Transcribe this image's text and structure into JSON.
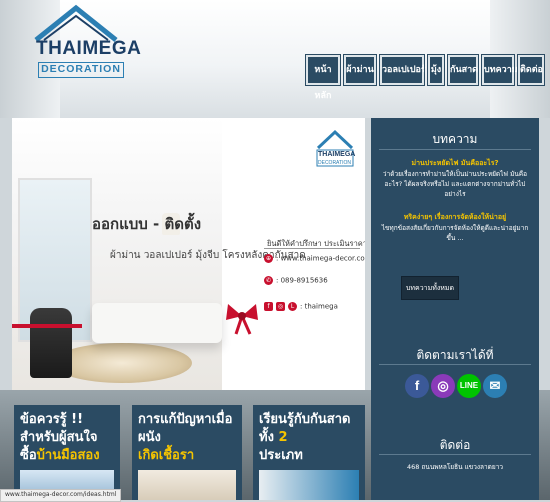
{
  "logo": {
    "title": "THAIMEGA",
    "subtitle": "DECORATION"
  },
  "nav": [
    "หน้าหลัก",
    "ผ้าม่าน",
    "วอลเปเปอร์",
    "มุ้ง",
    "กันสาด",
    "บทความ",
    "ติดต่อ"
  ],
  "slider": {
    "headline": "ออกแบบ - ติดตั้ง",
    "products": "ผ้าม่าน วอลเปเปอร์ มุ้งจีบ โครงหลังคากันสาด",
    "logo_title": "THAIMEGA",
    "logo_subtitle": "DECORATION",
    "tagline": "ยินดีให้คำปรึกษา ประเมินราคาฟรี",
    "website": ": www.thaimega-decor.com",
    "phone": ": 089-8915636",
    "social": ": thaimega"
  },
  "sidebar": {
    "articles_title": "บทความ",
    "article1_title": "ม่านประหยัดไฟ มันคืออะไร?",
    "article1_text": "ว่าด้วยเรื่องการทำม่านให้เป็นม่านประหยัดไฟ มันคืออะไร? ได้ผลจริงหรือไม่ และแตกต่างจากม่านทั่วไปอย่างไร",
    "article2_title": "ทริคง่ายๆ เรื่องการจัดห้องให้น่าอยู่",
    "article2_text": "ไขทุกข้อสงสัยเกี่ยวกับการจัดห้องให้ดูดีและน่าอยู่มากขึ้น ...",
    "read_more": "บทความทั้งหมด",
    "follow_title": "ติดตามเราได้ที่",
    "contact_title": "ติดต่อ",
    "contact_text": "468 ถนนพหลโยธิน แขวงลาดยาว"
  },
  "cards": [
    {
      "title": "ข้อควรรู้ !! สำหรับผู้สนใจซื้อ",
      "accent": "บ้านมือสอง"
    },
    {
      "title": "การแก้ปัญหาเมื่อผนัง",
      "accent": "เกิดเชื้อรา"
    },
    {
      "title": "เรียนรู้กับกันสาดทั้ง",
      "accent": "2",
      "tail": "ประเภท"
    }
  ],
  "status_url": "www.thaimega-decor.com/ideas.html",
  "colors": {
    "navy": "#2b4b63",
    "accent": "#f5c400",
    "brand_red": "#c8102e"
  },
  "icons": [
    "facebook-icon",
    "instagram-icon",
    "line-icon",
    "email-icon"
  ]
}
